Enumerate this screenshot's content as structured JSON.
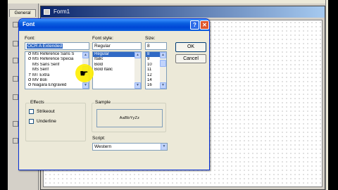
{
  "background": {
    "toolbox_tab": "General",
    "form_title": "Form1"
  },
  "dialog": {
    "title": "Font",
    "help_glyph": "?",
    "close_glyph": "✕",
    "font": {
      "label": "Font:",
      "value": "OCR A Extended",
      "items": [
        {
          "icon": "O",
          "name": "MS Reference Sans S"
        },
        {
          "icon": "O",
          "name": "MS Reference Specia"
        },
        {
          "icon": "",
          "name": "MS Sans Serif"
        },
        {
          "icon": "",
          "name": "MS Serif"
        },
        {
          "icon": "T",
          "name": "MT Extra"
        },
        {
          "icon": "O",
          "name": "MV Boli"
        },
        {
          "icon": "O",
          "name": "Niagara Engraved"
        }
      ]
    },
    "style": {
      "label": "Font style:",
      "value": "Regular",
      "items": [
        "Regular",
        "Italic",
        "Bold",
        "Bold Italic"
      ],
      "selected_index": 0
    },
    "size": {
      "label": "Size:",
      "value": "8",
      "items": [
        "8",
        "9",
        "10",
        "11",
        "12",
        "14",
        "16"
      ],
      "selected_index": 0
    },
    "ok_label": "OK",
    "cancel_label": "Cancel",
    "effects": {
      "label": "Effects",
      "strikeout_label": "Strikeout",
      "underline_label": "Underline"
    },
    "sample": {
      "label": "Sample",
      "text": "AaBbYyZz"
    },
    "script": {
      "label": "Script:",
      "value": "Western"
    }
  },
  "colors": {
    "titlebar": "#0a5fe0",
    "selection": "#316ac5",
    "highlight": "#ffee00"
  }
}
